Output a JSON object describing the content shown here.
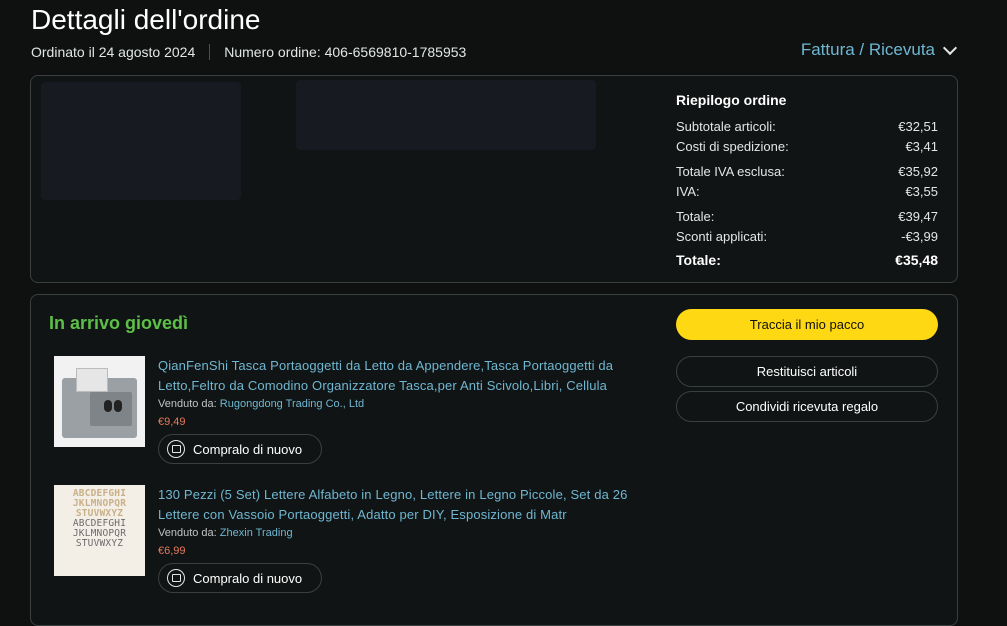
{
  "header": {
    "title": "Dettagli dell'ordine",
    "ordered_on": "Ordinato il 24 agosto 2024",
    "order_number": "Numero ordine: 406-6569810-1785953",
    "invoice_link": "Fattura / Ricevuta"
  },
  "summary": {
    "heading": "Riepilogo ordine",
    "rows": [
      {
        "label": "Subtotale articoli:",
        "value": "€32,51"
      },
      {
        "label": "Costi di spedizione:",
        "value": "€3,41"
      },
      {
        "label": "Totale IVA esclusa:",
        "value": "€35,92"
      },
      {
        "label": "IVA:",
        "value": "€3,55"
      },
      {
        "label": "Totale:",
        "value": "€39,47"
      },
      {
        "label": "Sconti applicati:",
        "value": "-€3,99"
      },
      {
        "label": "Totale:",
        "value": "€35,48"
      }
    ]
  },
  "shipment": {
    "status": "In arrivo giovedì",
    "track_button": "Traccia il mio pacco",
    "return_button": "Restituisci articoli",
    "gift_receipt_button": "Condividi ricevuta regalo"
  },
  "items": [
    {
      "title": "QianFenShi Tasca Portaoggetti da Letto da Appendere,Tasca Portaoggetti da Letto,Feltro da Comodino Organizzatore Tasca,per Anti Scivolo,Libri, Cellula",
      "seller_label": "Venduto da:",
      "seller": "Rugongdong Trading Co., Ltd",
      "price": "€9,49",
      "buy_again": "Compralo di nuovo"
    },
    {
      "title": "130 Pezzi (5 Set) Lettere Alfabeto in Legno, Lettere in Legno Piccole, Set da 26 Lettere con Vassoio Portaoggetti, Adatto per DIY, Esposizione di Matr",
      "seller_label": "Venduto da:",
      "seller": "Zhexin Trading",
      "price": "€6,99",
      "buy_again": "Compralo di nuovo"
    }
  ],
  "colors": {
    "background": "#0f1111",
    "link": "#6fb7d2",
    "status_green": "#5cc048",
    "track_button": "#ffd814",
    "price": "#e47a5e"
  }
}
